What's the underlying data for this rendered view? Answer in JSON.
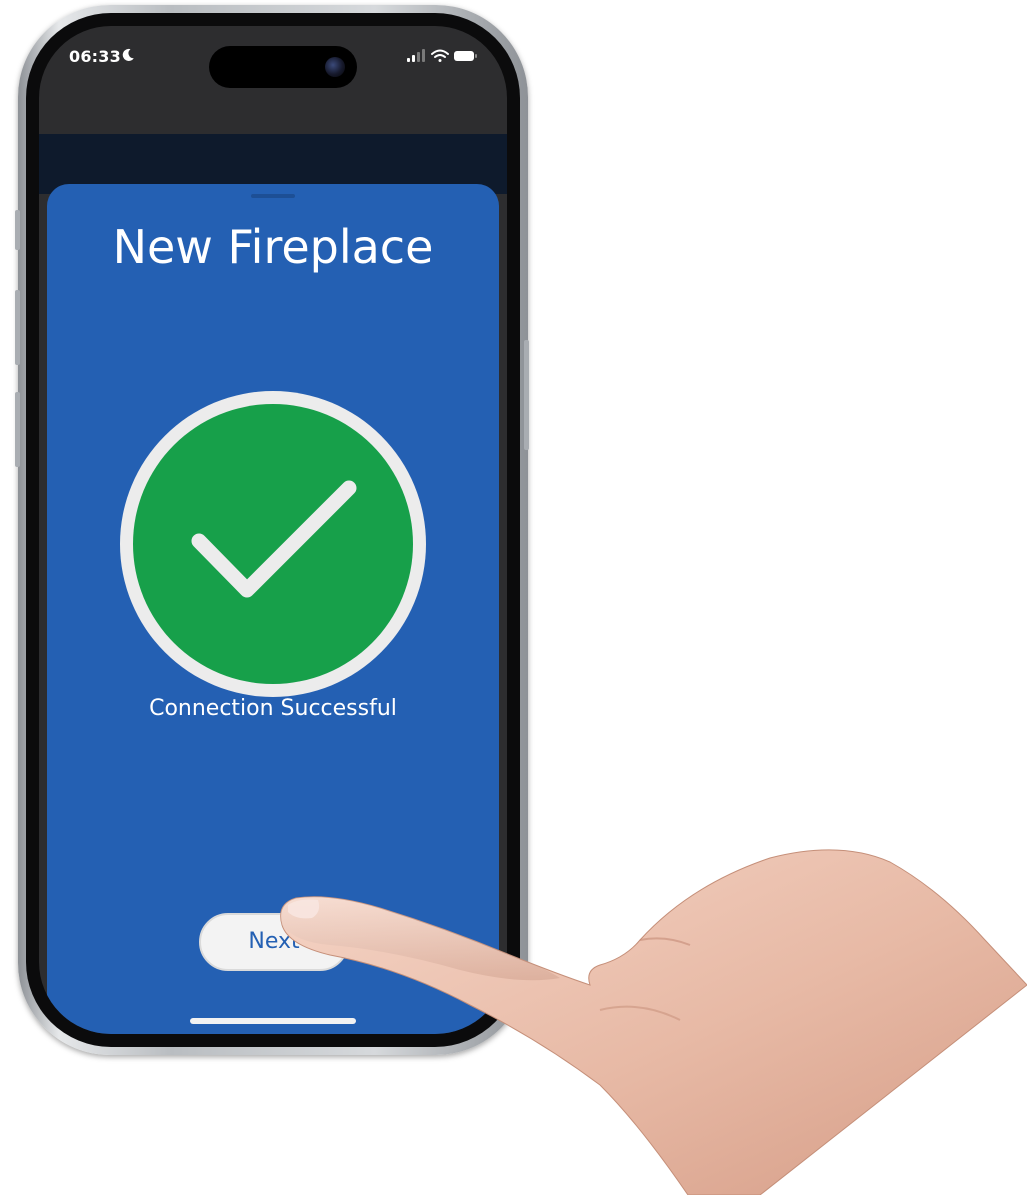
{
  "status_bar": {
    "time": "06:33",
    "icons": [
      "moon-icon",
      "signal-icon",
      "wifi-icon",
      "battery-icon"
    ]
  },
  "sheet": {
    "title": "New Fireplace",
    "status_icon": "checkmark-icon",
    "message": "Connection Successful",
    "next_button_label": "Next"
  },
  "colors": {
    "sheet_background": "#2460b3",
    "success_green": "#17a04a",
    "button_background": "#f3f3f3"
  }
}
